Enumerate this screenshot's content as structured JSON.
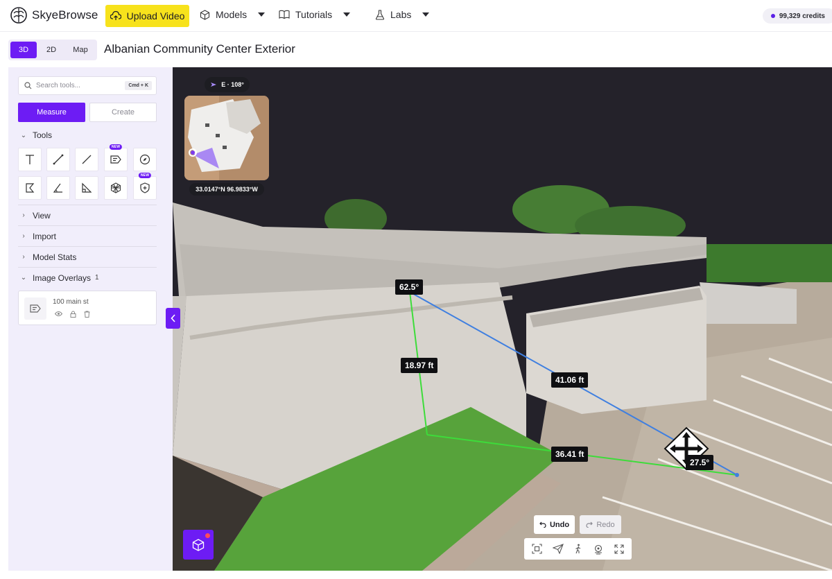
{
  "brand": {
    "name": "SkyeBrowse"
  },
  "topnav": {
    "upload_label": "Upload Video",
    "items": [
      {
        "label": "Models",
        "icon": "cube-icon"
      },
      {
        "label": "Tutorials",
        "icon": "book-icon"
      },
      {
        "label": "Labs",
        "icon": "flask-icon"
      }
    ],
    "credits": "99,329 credits"
  },
  "view_modes": [
    {
      "label": "3D",
      "active": true
    },
    {
      "label": "2D",
      "active": false
    },
    {
      "label": "Map",
      "active": false
    }
  ],
  "page_title": "Albanian Community Center Exterior",
  "sidebar": {
    "search": {
      "placeholder": "Search tools...",
      "shortcut": "Cmd + K"
    },
    "tabs": {
      "measure": "Measure",
      "create": "Create"
    },
    "sections": {
      "tools": "Tools",
      "view": "View",
      "import": "Import",
      "model_stats": "Model Stats",
      "image_overlays": "Image Overlays",
      "image_overlays_count": "1"
    },
    "tool_icons": [
      "text-icon",
      "line-measure-icon",
      "line-icon",
      "annotation-icon",
      "compass-icon",
      "area-polygon-icon",
      "angle-icon",
      "triangle-ruler-icon",
      "volume-mesh-icon",
      "shield-plus-icon"
    ],
    "new_tag": "NEW",
    "overlay_item": {
      "name": "100 main st"
    }
  },
  "viewport": {
    "compass": "E · 108°",
    "coordinates": "33.0147°N 96.9833°W",
    "measurements": {
      "angle_top": "62.5°",
      "vertical": "18.97 ft",
      "diagonal": "41.06 ft",
      "ground": "36.41 ft",
      "angle_bottom": "27.5°"
    },
    "undo": "Undo",
    "redo": "Redo",
    "colors": {
      "vertical_line": "#3ddc3a",
      "ground_line": "#3ddc3a",
      "diagonal_line": "#3f7fe0",
      "accent": "#6d1cf4"
    }
  }
}
